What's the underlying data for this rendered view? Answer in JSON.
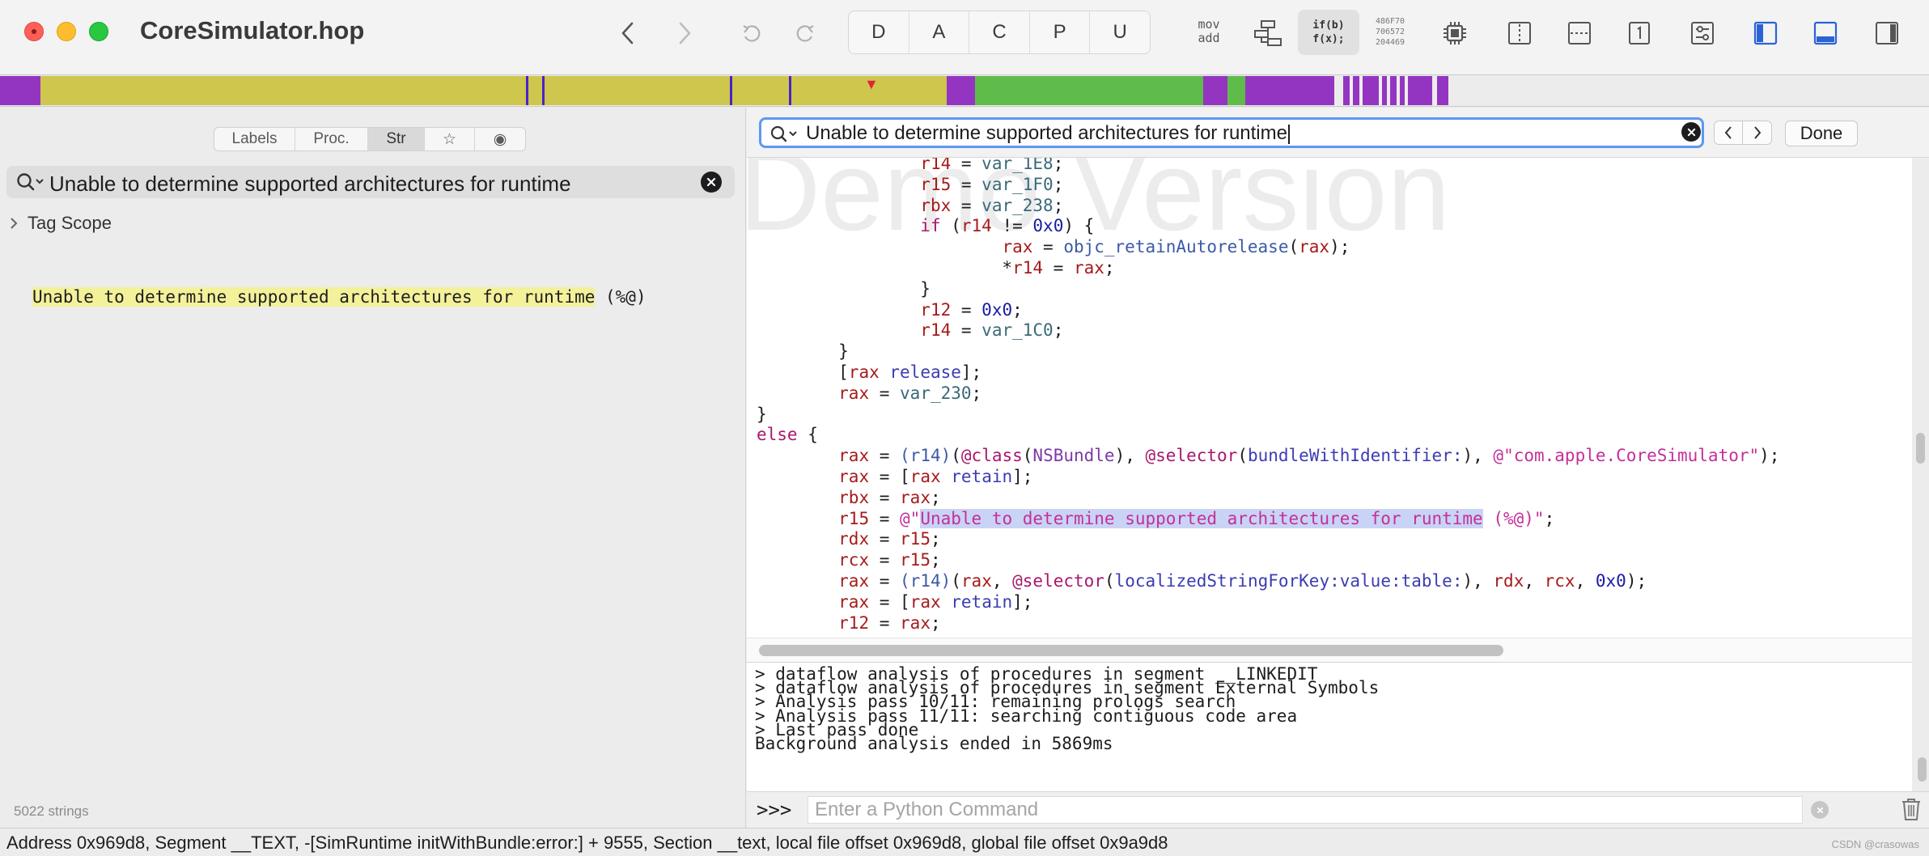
{
  "window": {
    "title": "CoreSimulator.hop"
  },
  "toolbar": {
    "modes": [
      "D",
      "A",
      "C",
      "P",
      "U"
    ],
    "mov_add": [
      "mov",
      "add"
    ],
    "if_bf": [
      "if(b)",
      "f(x);"
    ],
    "hex_nums": [
      "486F70",
      "706572",
      "204469"
    ],
    "icons": [
      "back-icon",
      "forward-icon",
      "undo-icon",
      "redo-icon",
      "cpu-icon",
      "split-vertical-icon",
      "split-horizontal-icon",
      "page-one-icon",
      "sliders-icon",
      "left-panel-icon",
      "bottom-panel-icon",
      "right-panel-icon"
    ]
  },
  "colors": {
    "nav_olive": "#cec64d",
    "nav_purple": "#9435c2",
    "nav_green": "#5fbc4b",
    "accent_blue": "#2a63d6",
    "search_highlight": "#f3f19a",
    "code_highlight": "#c9d3f5"
  },
  "left_panel": {
    "tabs": [
      "Labels",
      "Proc.",
      "Str",
      "☆",
      "◉"
    ],
    "active_tab": "Str",
    "search_value": "Unable to determine supported architectures for runtime",
    "tag_scope": "Tag Scope",
    "result": {
      "match": "Unable to determine supported architectures for runtime",
      "rest": " (%@)"
    },
    "string_count": "5022 strings"
  },
  "findbar": {
    "value": "Unable to determine supported architectures for runtime",
    "done_label": "Done"
  },
  "code": {
    "watermark": "Demo Version",
    "lines": [
      [
        {
          "t": "                ",
          "c": ""
        },
        {
          "t": "r14",
          "c": "reg"
        },
        {
          "t": " = ",
          "c": ""
        },
        {
          "t": "var_1E8",
          "c": "var"
        },
        {
          "t": ";",
          "c": ""
        }
      ],
      [
        {
          "t": "                ",
          "c": ""
        },
        {
          "t": "r15",
          "c": "reg"
        },
        {
          "t": " = ",
          "c": ""
        },
        {
          "t": "var_1F0",
          "c": "var"
        },
        {
          "t": ";",
          "c": ""
        }
      ],
      [
        {
          "t": "                ",
          "c": ""
        },
        {
          "t": "rbx",
          "c": "reg"
        },
        {
          "t": " = ",
          "c": ""
        },
        {
          "t": "var_238",
          "c": "var"
        },
        {
          "t": ";",
          "c": ""
        }
      ],
      [
        {
          "t": "                ",
          "c": ""
        },
        {
          "t": "if",
          "c": "kw"
        },
        {
          "t": " (",
          "c": ""
        },
        {
          "t": "r14",
          "c": "reg"
        },
        {
          "t": " != ",
          "c": ""
        },
        {
          "t": "0x0",
          "c": "num"
        },
        {
          "t": ") {",
          "c": ""
        }
      ],
      [
        {
          "t": "                        ",
          "c": ""
        },
        {
          "t": "rax",
          "c": "reg"
        },
        {
          "t": " = ",
          "c": ""
        },
        {
          "t": "objc_retainAutorelease",
          "c": "fn"
        },
        {
          "t": "(",
          "c": ""
        },
        {
          "t": "rax",
          "c": "reg"
        },
        {
          "t": ");",
          "c": ""
        }
      ],
      [
        {
          "t": "                        *",
          "c": ""
        },
        {
          "t": "r14",
          "c": "reg"
        },
        {
          "t": " = ",
          "c": ""
        },
        {
          "t": "rax",
          "c": "reg"
        },
        {
          "t": ";",
          "c": ""
        }
      ],
      [
        {
          "t": "                }",
          "c": ""
        }
      ],
      [
        {
          "t": "                ",
          "c": ""
        },
        {
          "t": "r12",
          "c": "reg"
        },
        {
          "t": " = ",
          "c": ""
        },
        {
          "t": "0x0",
          "c": "num"
        },
        {
          "t": ";",
          "c": ""
        }
      ],
      [
        {
          "t": "                ",
          "c": ""
        },
        {
          "t": "r14",
          "c": "reg"
        },
        {
          "t": " = ",
          "c": ""
        },
        {
          "t": "var_1C0",
          "c": "var"
        },
        {
          "t": ";",
          "c": ""
        }
      ],
      [
        {
          "t": "        }",
          "c": ""
        }
      ],
      [
        {
          "t": "        [",
          "c": ""
        },
        {
          "t": "rax",
          "c": "reg"
        },
        {
          "t": " ",
          "c": ""
        },
        {
          "t": "release",
          "c": "sel"
        },
        {
          "t": "];",
          "c": ""
        }
      ],
      [
        {
          "t": "        ",
          "c": ""
        },
        {
          "t": "rax",
          "c": "reg"
        },
        {
          "t": " = ",
          "c": ""
        },
        {
          "t": "var_230",
          "c": "var"
        },
        {
          "t": ";",
          "c": ""
        }
      ],
      [
        {
          "t": "}",
          "c": ""
        }
      ],
      [
        {
          "t": "else",
          "c": "kw"
        },
        {
          "t": " {",
          "c": ""
        }
      ],
      [
        {
          "t": "        ",
          "c": ""
        },
        {
          "t": "rax",
          "c": "reg"
        },
        {
          "t": " = ",
          "c": ""
        },
        {
          "t": "(r14)",
          "c": "fn"
        },
        {
          "t": "(",
          "c": ""
        },
        {
          "t": "@class",
          "c": "kw"
        },
        {
          "t": "(",
          "c": ""
        },
        {
          "t": "NSBundle",
          "c": "cls"
        },
        {
          "t": "), ",
          "c": ""
        },
        {
          "t": "@selector",
          "c": "kw"
        },
        {
          "t": "(",
          "c": ""
        },
        {
          "t": "bundleWithIdentifier:",
          "c": "sel"
        },
        {
          "t": "), ",
          "c": ""
        },
        {
          "t": "@\"com.apple.CoreSimulator\"",
          "c": "str"
        },
        {
          "t": ");",
          "c": ""
        }
      ],
      [
        {
          "t": "        ",
          "c": ""
        },
        {
          "t": "rax",
          "c": "reg"
        },
        {
          "t": " = [",
          "c": ""
        },
        {
          "t": "rax",
          "c": "reg"
        },
        {
          "t": " ",
          "c": ""
        },
        {
          "t": "retain",
          "c": "sel"
        },
        {
          "t": "];",
          "c": ""
        }
      ],
      [
        {
          "t": "        ",
          "c": ""
        },
        {
          "t": "rbx",
          "c": "reg"
        },
        {
          "t": " = ",
          "c": ""
        },
        {
          "t": "rax",
          "c": "reg"
        },
        {
          "t": ";",
          "c": ""
        }
      ],
      [
        {
          "t": "        ",
          "c": ""
        },
        {
          "t": "r15",
          "c": "reg"
        },
        {
          "t": " = ",
          "c": ""
        },
        {
          "t": "@\"",
          "c": "str"
        },
        {
          "t": "Unable to determine supported architectures for runtime",
          "c": "str strhl"
        },
        {
          "t": " (%@)\"",
          "c": "str"
        },
        {
          "t": ";",
          "c": ""
        }
      ],
      [
        {
          "t": "        ",
          "c": ""
        },
        {
          "t": "rdx",
          "c": "reg"
        },
        {
          "t": " = ",
          "c": ""
        },
        {
          "t": "r15",
          "c": "reg"
        },
        {
          "t": ";",
          "c": ""
        }
      ],
      [
        {
          "t": "        ",
          "c": ""
        },
        {
          "t": "rcx",
          "c": "reg"
        },
        {
          "t": " = ",
          "c": ""
        },
        {
          "t": "r15",
          "c": "reg"
        },
        {
          "t": ";",
          "c": ""
        }
      ],
      [
        {
          "t": "        ",
          "c": ""
        },
        {
          "t": "rax",
          "c": "reg"
        },
        {
          "t": " = ",
          "c": ""
        },
        {
          "t": "(r14)",
          "c": "fn"
        },
        {
          "t": "(",
          "c": ""
        },
        {
          "t": "rax",
          "c": "reg"
        },
        {
          "t": ", ",
          "c": ""
        },
        {
          "t": "@selector",
          "c": "kw"
        },
        {
          "t": "(",
          "c": ""
        },
        {
          "t": "localizedStringForKey:value:table:",
          "c": "sel"
        },
        {
          "t": "), ",
          "c": ""
        },
        {
          "t": "rdx",
          "c": "reg"
        },
        {
          "t": ", ",
          "c": ""
        },
        {
          "t": "rcx",
          "c": "reg"
        },
        {
          "t": ", ",
          "c": ""
        },
        {
          "t": "0x0",
          "c": "num"
        },
        {
          "t": ");",
          "c": ""
        }
      ],
      [
        {
          "t": "        ",
          "c": ""
        },
        {
          "t": "rax",
          "c": "reg"
        },
        {
          "t": " = [",
          "c": ""
        },
        {
          "t": "rax",
          "c": "reg"
        },
        {
          "t": " ",
          "c": ""
        },
        {
          "t": "retain",
          "c": "sel"
        },
        {
          "t": "];",
          "c": ""
        }
      ],
      [
        {
          "t": "        ",
          "c": ""
        },
        {
          "t": "r12",
          "c": "reg"
        },
        {
          "t": " = ",
          "c": ""
        },
        {
          "t": "rax",
          "c": "reg"
        },
        {
          "t": ";",
          "c": ""
        }
      ]
    ]
  },
  "console": {
    "lines": [
      "> dataflow analysis of procedures in segment __LINKEDIT",
      "> dataflow analysis of procedures in segment External Symbols",
      "> Analysis pass 10/11: remaining prologs search",
      "> Analysis pass 11/11: searching contiguous code area",
      "> Last pass done",
      "Background analysis ended in 5869ms"
    ],
    "prompt": ">>>",
    "input_placeholder": "Enter a Python Command"
  },
  "statusbar": {
    "text": "Address 0x969d8, Segment __TEXT, -[SimRuntime initWithBundle:error:] + 9555, Section __text, local file offset 0x969d8, global file offset 0x9a9d8",
    "credit": "CSDN @crasowas"
  }
}
